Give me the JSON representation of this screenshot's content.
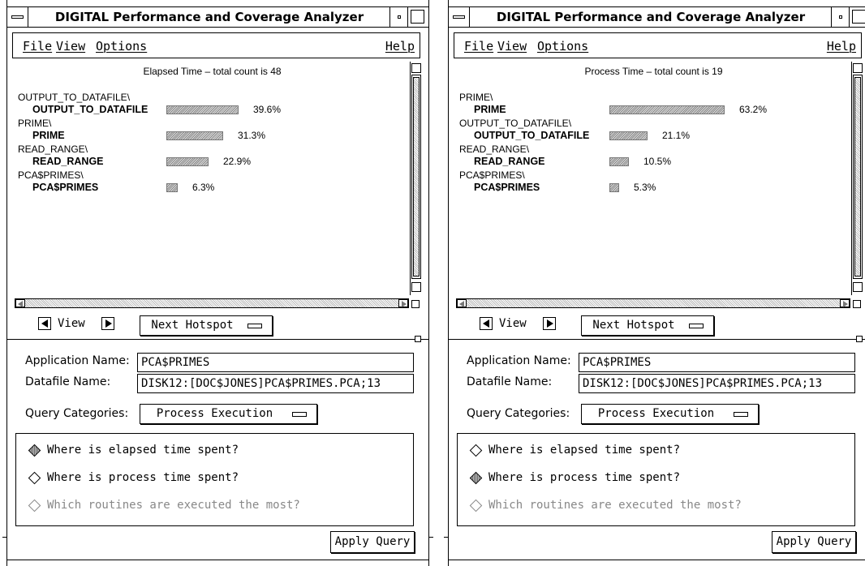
{
  "windows": [
    {
      "title": "DIGITAL Performance and Coverage Analyzer",
      "menu": {
        "file": "File",
        "view": "View",
        "options": "Options",
        "help": "Help"
      },
      "chart_title": "Elapsed Time – total count is 48",
      "rows": [
        {
          "parent": "OUTPUT_TO_DATAFILE\\",
          "child": "OUTPUT_TO_DATAFILE",
          "percent": 39.6,
          "label": "39.6%"
        },
        {
          "parent": "PRIME\\",
          "child": "PRIME",
          "percent": 31.3,
          "label": "31.3%"
        },
        {
          "parent": "READ_RANGE\\",
          "child": "READ_RANGE",
          "percent": 22.9,
          "label": "22.9%"
        },
        {
          "parent": "PCA$PRIMES\\",
          "child": "PCA$PRIMES",
          "percent": 6.3,
          "label": "6.3%"
        }
      ],
      "view_label": "View",
      "next_hotspot": "Next Hotspot",
      "application_name_label": "Application Name:",
      "application_name": "PCA$PRIMES",
      "datafile_name_label": "Datafile Name:",
      "datafile_name": "DISK12:[DOC$JONES]PCA$PRIMES.PCA;13",
      "query_categories_label": "Query Categories:",
      "query_category": "Process Execution",
      "queries": [
        {
          "text": "Where is elapsed time spent?",
          "selected": true,
          "enabled": true
        },
        {
          "text": "Where is process time spent?",
          "selected": false,
          "enabled": true
        },
        {
          "text": "Which routines are executed the most?",
          "selected": false,
          "enabled": false
        }
      ],
      "apply_query": "Apply Query"
    },
    {
      "title": "DIGITAL Performance and Coverage Analyzer",
      "menu": {
        "file": "File",
        "view": "View",
        "options": "Options",
        "help": "Help"
      },
      "chart_title": "Process Time – total count is 19",
      "rows": [
        {
          "parent": "PRIME\\",
          "child": "PRIME",
          "percent": 63.2,
          "label": "63.2%"
        },
        {
          "parent": "OUTPUT_TO_DATAFILE\\",
          "child": "OUTPUT_TO_DATAFILE",
          "percent": 21.1,
          "label": "21.1%"
        },
        {
          "parent": "READ_RANGE\\",
          "child": "READ_RANGE",
          "percent": 10.5,
          "label": "10.5%"
        },
        {
          "parent": "PCA$PRIMES\\",
          "child": "PCA$PRIMES",
          "percent": 5.3,
          "label": "5.3%"
        }
      ],
      "view_label": "View",
      "next_hotspot": "Next Hotspot",
      "application_name_label": "Application Name:",
      "application_name": "PCA$PRIMES",
      "datafile_name_label": "Datafile Name:",
      "datafile_name": "DISK12:[DOC$JONES]PCA$PRIMES.PCA;13",
      "query_categories_label": "Query Categories:",
      "query_category": "Process Execution",
      "queries": [
        {
          "text": "Where is elapsed time spent?",
          "selected": false,
          "enabled": true
        },
        {
          "text": "Where is process time spent?",
          "selected": true,
          "enabled": true
        },
        {
          "text": "Which routines are executed the most?",
          "selected": false,
          "enabled": false
        }
      ],
      "apply_query": "Apply Query"
    }
  ]
}
